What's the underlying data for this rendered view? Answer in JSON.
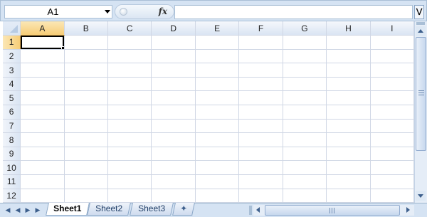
{
  "formula_bar": {
    "name_box_value": "A1",
    "fx_label": "fx",
    "formula_value": ""
  },
  "grid": {
    "columns": [
      "A",
      "B",
      "C",
      "D",
      "E",
      "F",
      "G",
      "H",
      "I"
    ],
    "rows": [
      "1",
      "2",
      "3",
      "4",
      "5",
      "6",
      "7",
      "8",
      "9",
      "10",
      "11",
      "12"
    ],
    "active_cell": "A1"
  },
  "sheet_tabs": [
    {
      "label": "Sheet1",
      "active": true
    },
    {
      "label": "Sheet2",
      "active": false
    },
    {
      "label": "Sheet3",
      "active": false
    }
  ],
  "icons": {
    "nav_first": "first-sheet-icon",
    "nav_prev": "previous-sheet-icon",
    "nav_next": "next-sheet-icon",
    "nav_last": "last-sheet-icon",
    "insert_sheet": "insert-sheet-icon"
  },
  "colors": {
    "header_active": "#f7cd77",
    "header_bg": "#dae5f3",
    "gridline": "#d0d7e5",
    "chrome": "#d5e3f3"
  }
}
